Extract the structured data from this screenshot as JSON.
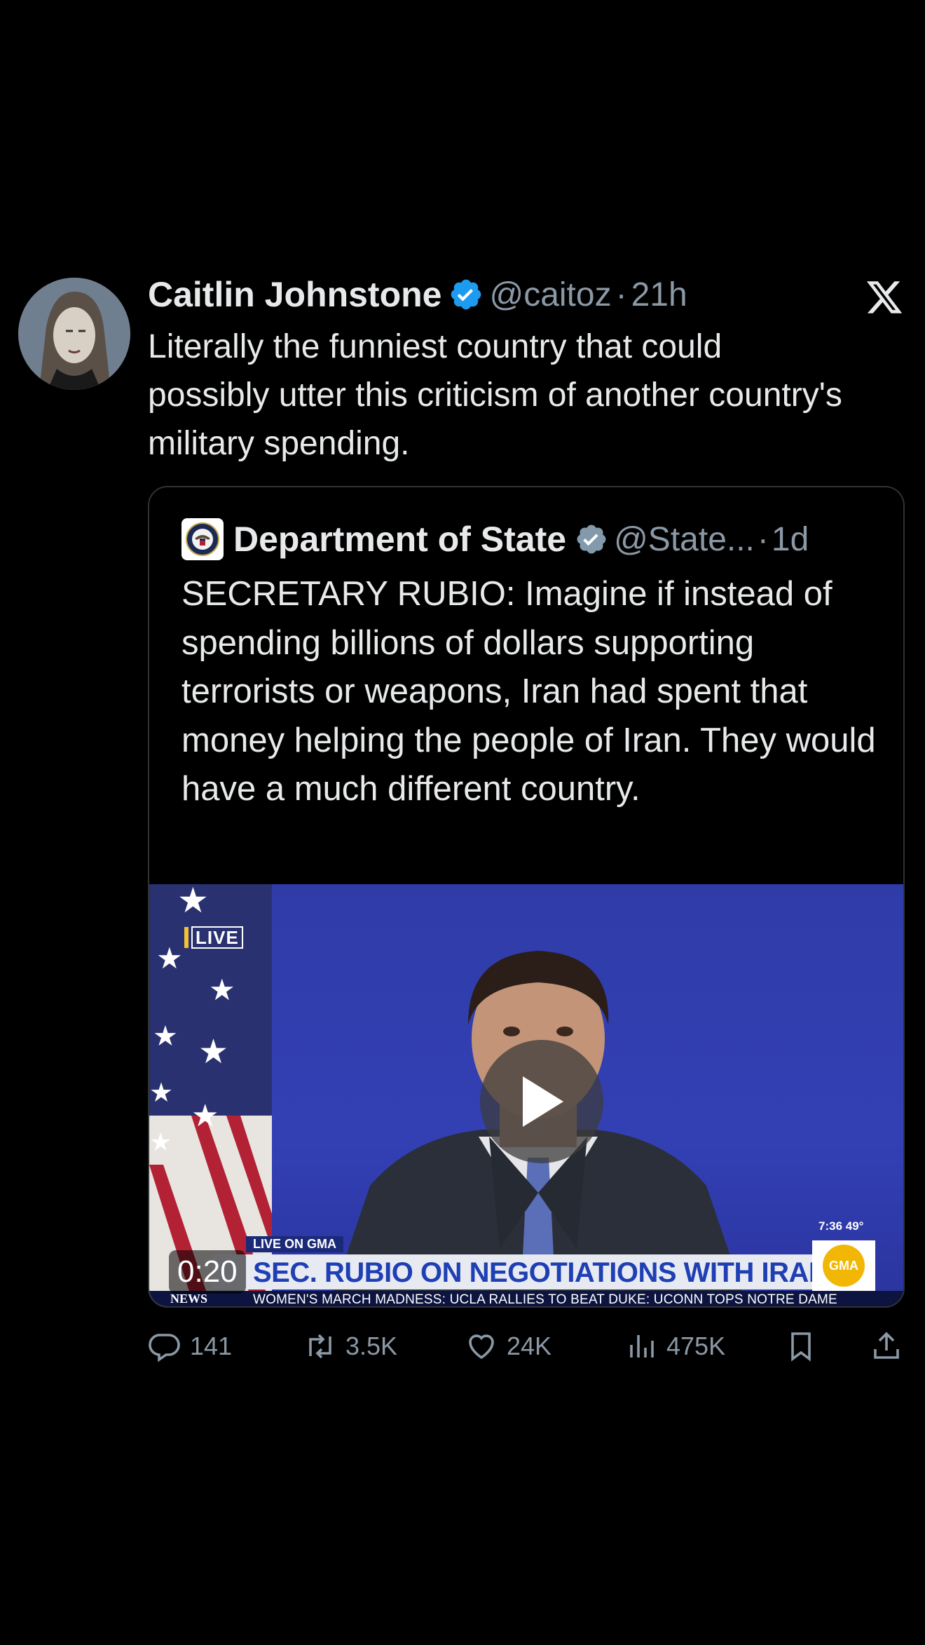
{
  "author": {
    "name": "Caitlin Johnstone",
    "handle": "@caitoz",
    "dot": "·",
    "time": "21h"
  },
  "tweet_text": "Literally the funniest country that could possibly utter this criticism of another country's military spending.",
  "quote": {
    "name": "Department of State",
    "handle": "@State...",
    "dot": "·",
    "time": "1d",
    "text": "SECRETARY RUBIO: Imagine if instead of spending billions of dollars supporting terrorists or weapons, Iran had spent that money helping the people of Iran. They would have a much different country."
  },
  "video": {
    "duration": "0:20",
    "live_label": "LIVE",
    "live_on": "LIVE ON GMA",
    "banner": "SEC. RUBIO ON NEGOTIATIONS WITH IRAN",
    "clock": "7:36  49°",
    "gma": "GMA",
    "network": "NEWS",
    "ticker": "WOMEN'S MARCH MADNESS:  UCLA RALLIES TO BEAT DUKE:  UCONN TOPS NOTRE DAME"
  },
  "actions": {
    "replies": "141",
    "reposts": "3.5K",
    "likes": "24K",
    "views": "475K"
  },
  "colors": {
    "background": "#000000",
    "text": "#e7e9ea",
    "secondary": "#8b98a5",
    "verified_blue": "#1d9bf0",
    "verified_gray": "#829aab"
  },
  "icons": [
    "x-logo-icon",
    "verified-badge-icon",
    "reply-icon",
    "repost-icon",
    "like-icon",
    "views-icon",
    "bookmark-icon",
    "share-icon",
    "play-icon"
  ]
}
